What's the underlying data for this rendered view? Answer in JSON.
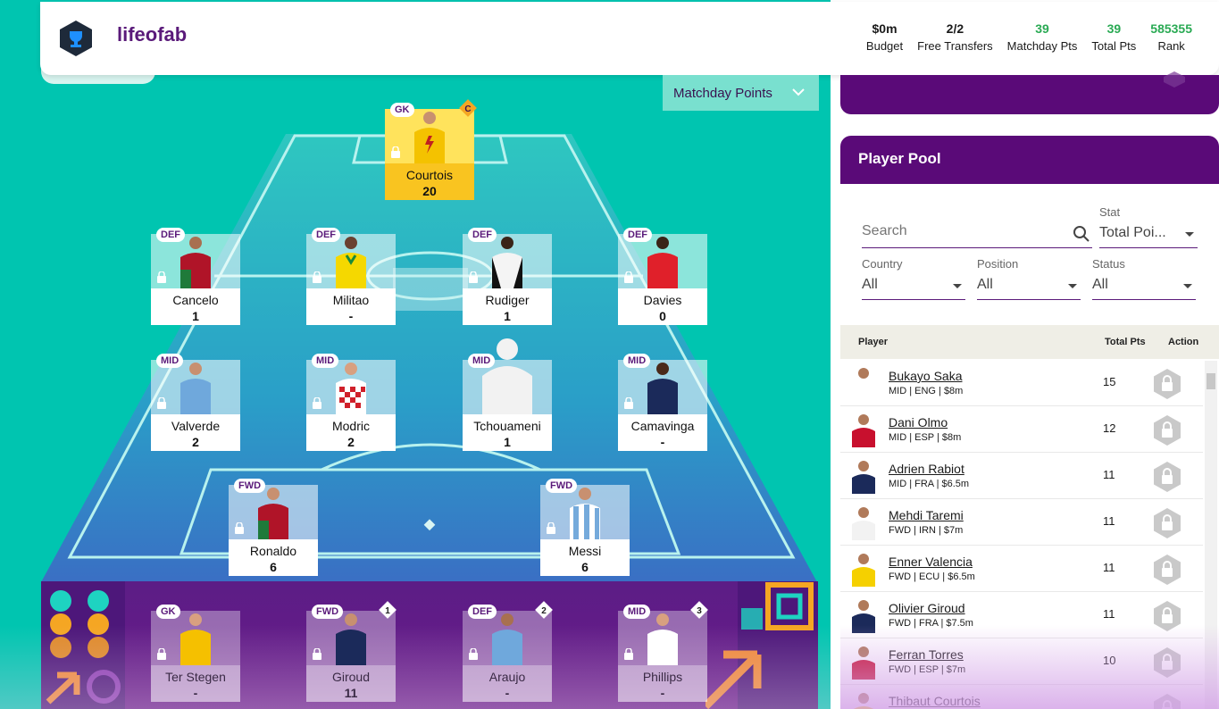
{
  "header": {
    "team_name": "lifeofab",
    "stats": [
      {
        "value": "$0m",
        "label": "Budget",
        "green": false
      },
      {
        "value": "2/2",
        "label": "Free Transfers",
        "green": false
      },
      {
        "value": "39",
        "label": "Matchday Pts",
        "green": true
      },
      {
        "value": "39",
        "label": "Total Pts",
        "green": true
      },
      {
        "value": "585355",
        "label": "Rank",
        "green": true
      }
    ]
  },
  "view_select": {
    "label": "Matchday Points"
  },
  "captain_badge": "C",
  "squad": {
    "gk": {
      "pos": "GK",
      "name": "Courtois",
      "points": "20"
    },
    "def": [
      {
        "pos": "DEF",
        "name": "Cancelo",
        "points": "1"
      },
      {
        "pos": "DEF",
        "name": "Militao",
        "points": "-"
      },
      {
        "pos": "DEF",
        "name": "Rudiger",
        "points": "1"
      },
      {
        "pos": "DEF",
        "name": "Davies",
        "points": "0"
      }
    ],
    "mid": [
      {
        "pos": "MID",
        "name": "Valverde",
        "points": "2"
      },
      {
        "pos": "MID",
        "name": "Modric",
        "points": "2"
      },
      {
        "pos": "MID",
        "name": "Tchouameni",
        "points": "1"
      },
      {
        "pos": "MID",
        "name": "Camavinga",
        "points": "-"
      }
    ],
    "fwd": [
      {
        "pos": "FWD",
        "name": "Ronaldo",
        "points": "6"
      },
      {
        "pos": "FWD",
        "name": "Messi",
        "points": "6"
      }
    ],
    "bench": [
      {
        "pos": "GK",
        "name": "Ter Stegen",
        "points": "-",
        "order": ""
      },
      {
        "pos": "FWD",
        "name": "Giroud",
        "points": "11",
        "order": "1"
      },
      {
        "pos": "DEF",
        "name": "Araujo",
        "points": "-",
        "order": "2"
      },
      {
        "pos": "MID",
        "name": "Phillips",
        "points": "-",
        "order": "3"
      }
    ]
  },
  "pool": {
    "title": "Player Pool",
    "search_placeholder": "Search",
    "stat": {
      "label": "Stat",
      "value": "Total Poi..."
    },
    "country": {
      "label": "Country",
      "value": "All"
    },
    "position": {
      "label": "Position",
      "value": "All"
    },
    "status": {
      "label": "Status",
      "value": "All"
    },
    "columns": {
      "player": "Player",
      "total": "Total Pts",
      "action": "Action"
    },
    "rows": [
      {
        "name": "Bukayo Saka",
        "detail": "MID | ENG | $8m",
        "pts": "15",
        "kit": "#ffffff"
      },
      {
        "name": "Dani Olmo",
        "detail": "MID | ESP | $8m",
        "pts": "12",
        "kit": "#c8102e"
      },
      {
        "name": "Adrien Rabiot",
        "detail": "MID | FRA | $6.5m",
        "pts": "11",
        "kit": "#1b2a5a"
      },
      {
        "name": "Mehdi Taremi",
        "detail": "FWD | IRN | $7m",
        "pts": "11",
        "kit": "#f2f2f2"
      },
      {
        "name": "Enner Valencia",
        "detail": "FWD | ECU | $6.5m",
        "pts": "11",
        "kit": "#f5d000"
      },
      {
        "name": "Olivier Giroud",
        "detail": "FWD | FRA | $7.5m",
        "pts": "11",
        "kit": "#1b2a5a"
      },
      {
        "name": "Ferran Torres",
        "detail": "FWD | ESP | $7m",
        "pts": "10",
        "kit": "#c8102e"
      },
      {
        "name": "Thibaut Courtois",
        "detail": "",
        "pts": "",
        "kit": "#f5d000"
      }
    ]
  },
  "colors": {
    "purple": "#5a0a78",
    "teal": "#00c5b0",
    "gold": "#f9c420",
    "green": "#2aaa54"
  }
}
